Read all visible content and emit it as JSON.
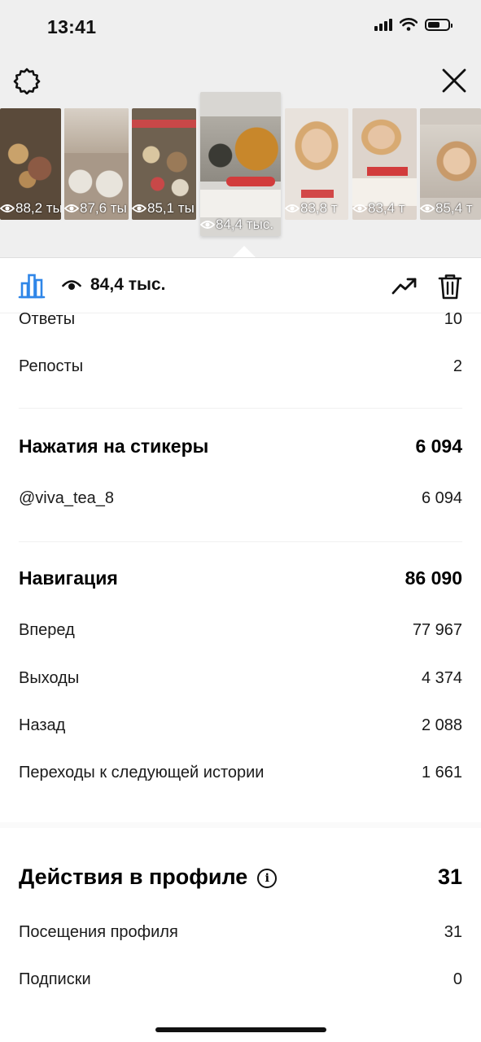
{
  "status_bar": {
    "time": "13:41"
  },
  "thumbnails": [
    {
      "views": "88,2 ты",
      "bg": "#5a4a3a",
      "accent": "#c9a26b"
    },
    {
      "views": "87,6 ты",
      "bg": "#a89888",
      "accent": "#e8e4dc"
    },
    {
      "views": "85,1 ты",
      "bg": "#6f6150",
      "accent": "#c84848"
    },
    {
      "views": "84,4 тыс.",
      "bg": "#d8d6d2",
      "accent": "#c8872b",
      "active": true
    },
    {
      "views": "83,8 т",
      "bg": "#e8e2dc",
      "accent": "#d24848"
    },
    {
      "views": "83,4 т",
      "bg": "#ddd4cc",
      "accent": "#d23c3c"
    },
    {
      "views": "85,4 т",
      "bg": "#cfc8c0",
      "accent": "#8a7e72"
    }
  ],
  "toolbar": {
    "views": "84,4 тыс."
  },
  "rows": {
    "otvety": {
      "label": "Ответы",
      "value": "10"
    },
    "reposty": {
      "label": "Репосты",
      "value": "2"
    },
    "stickers_head": {
      "label": "Нажатия на стикеры",
      "value": "6 094"
    },
    "sticker_viva": {
      "label": "@viva_tea_8",
      "value": "6 094"
    },
    "nav_head": {
      "label": "Навигация",
      "value": "86 090"
    },
    "vpered": {
      "label": "Вперед",
      "value": "77 967"
    },
    "vyhody": {
      "label": "Выходы",
      "value": "4 374"
    },
    "nazad": {
      "label": "Назад",
      "value": "2 088"
    },
    "perehody": {
      "label": "Переходы к следующей истории",
      "value": "1 661"
    },
    "profile_head": {
      "label": "Действия в профиле",
      "value": "31"
    },
    "poseshcheniya": {
      "label": "Посещения профиля",
      "value": "31"
    },
    "podpiski": {
      "label": "Подписки",
      "value": "0"
    }
  },
  "colors": {
    "accent_blue": "#2f86e8",
    "text": "#111111",
    "divider": "#f1f1f1"
  }
}
